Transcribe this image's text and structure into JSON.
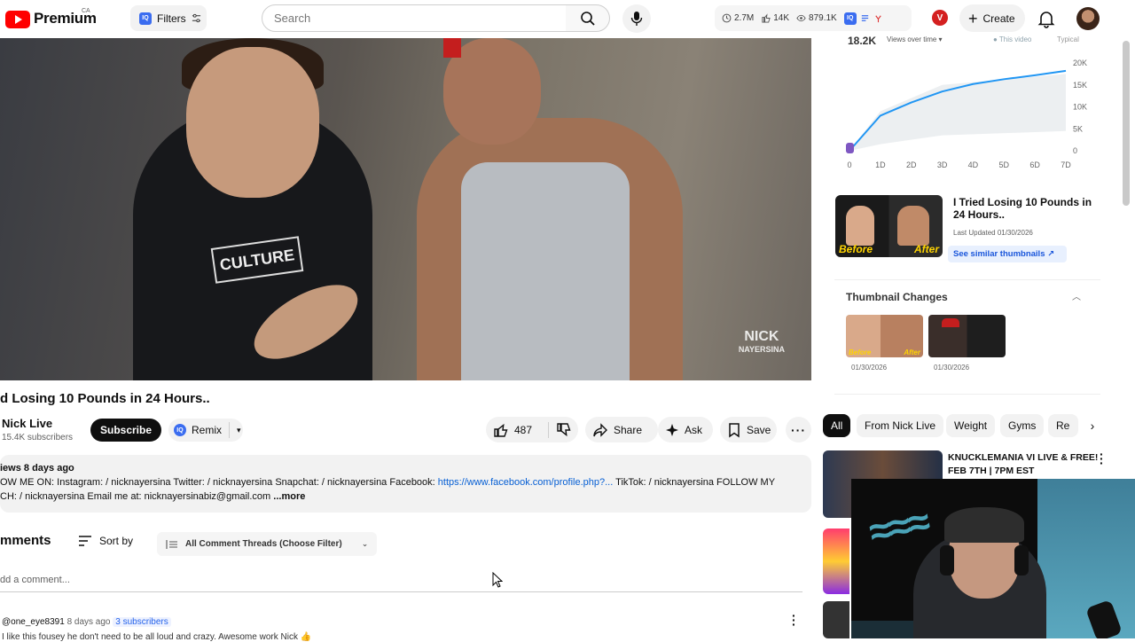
{
  "header": {
    "brand": "Premium",
    "region": "CA",
    "filters_label": "Filters",
    "search_placeholder": "Search",
    "stats": [
      {
        "icon": "clock-icon",
        "value": "2.7M"
      },
      {
        "icon": "thumbs-up-icon",
        "value": "14K"
      },
      {
        "icon": "eye-icon",
        "value": "879.1K"
      }
    ],
    "create_label": "Create"
  },
  "video": {
    "watermark_line1": "NICK",
    "watermark_line2": "NAYERSINA",
    "shirt_text": "CULTURE",
    "title": "d Losing 10 Pounds in 24 Hours..",
    "channel": "Nick Live",
    "subscribers": "15.4K subscribers",
    "subscribe_label": "Subscribe",
    "remix_label": "Remix",
    "like_count": "487",
    "share_label": "Share",
    "ask_label": "Ask",
    "save_label": "Save"
  },
  "description": {
    "meta": "iews  8 days ago",
    "line1_a": "OW ME ON: Instagram: / nicknayersina Twitter: / nicknayersina Snapchat: / nicknayersina Facebook: ",
    "line1_link": "https://www.facebook.com/profile.php?...",
    "line1_b": " TikTok: / nicknayersina FOLLOW MY",
    "line2": "CH: / nicknayersina Email me at: nicknayersinabiz@gmail.com ",
    "more": "...more"
  },
  "comments": {
    "title": "mments",
    "sort_label": "Sort by",
    "filter_label": "All Comment Threads (Choose Filter)",
    "add_placeholder": "dd a comment...",
    "first": {
      "author": "@one_eye8391",
      "time": "8 days ago",
      "subs": "3 subscribers",
      "text": "I like this fousey he don't need to be all loud and crazy. Awesome work Nick 👍"
    }
  },
  "analytics": {
    "headline": "18.2K",
    "select": "Views over time ▾",
    "legend_this": "● This video",
    "legend_typical": "Typical",
    "accent_color": "#2196f3"
  },
  "chart_data": {
    "type": "line",
    "x": [
      "0",
      "1D",
      "2D",
      "3D",
      "4D",
      "5D",
      "6D",
      "7D"
    ],
    "series": [
      {
        "name": "This video",
        "values": [
          0,
          8000,
          11000,
          13500,
          15200,
          16300,
          17200,
          18200
        ]
      }
    ],
    "y_ticks": [
      "20K",
      "15K",
      "10K",
      "5K",
      "0"
    ],
    "ylim": [
      0,
      20000
    ]
  },
  "similar": {
    "title": "I Tried Losing 10 Pounds in 24 Hours..",
    "last_updated": "Last Updated 01/30/2026",
    "button_label": "See similar thumbnails ↗",
    "before": "Before",
    "after": "After"
  },
  "thumbnail_changes": {
    "title": "Thumbnail Changes",
    "items": [
      {
        "date": "01/30/2026"
      },
      {
        "date": "01/30/2026"
      }
    ]
  },
  "chips": [
    {
      "label": "All",
      "active": true
    },
    {
      "label": "From Nick Live"
    },
    {
      "label": "Weight"
    },
    {
      "label": "Gyms"
    },
    {
      "label": "Re"
    }
  ],
  "recommended": {
    "title": "KNUCKLEMANIA VI LIVE & FREE! FEB 7TH | 7PM EST"
  }
}
